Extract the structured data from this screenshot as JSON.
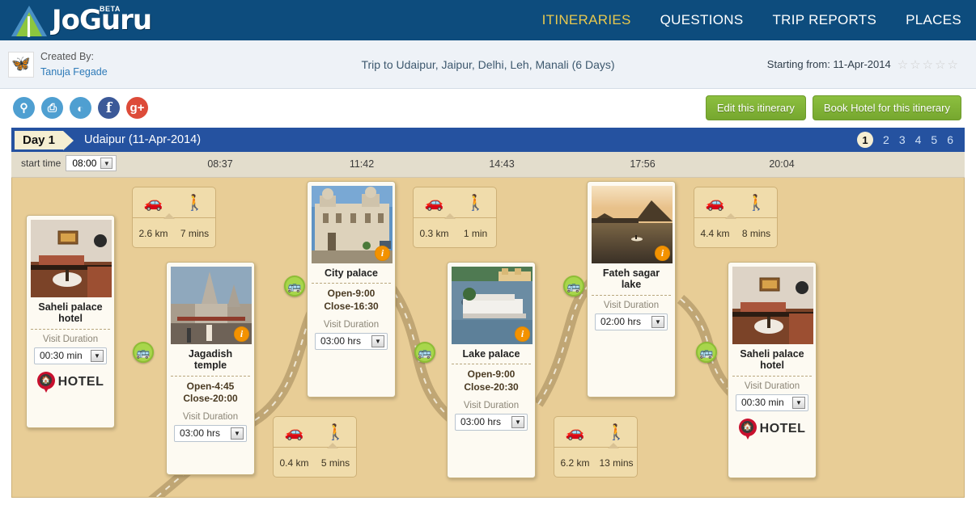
{
  "brand": {
    "name": "JoGuru",
    "beta": "BETA",
    "logo_icon": "road-triangle-logo"
  },
  "nav": {
    "items": [
      {
        "label": "ITINERARIES",
        "active": true
      },
      {
        "label": "QUESTIONS",
        "active": false
      },
      {
        "label": "TRIP REPORTS",
        "active": false
      },
      {
        "label": "PLACES",
        "active": false
      }
    ]
  },
  "subheader": {
    "created_by_label": "Created By:",
    "creator_name": "Tanuja Fegade",
    "trip_title": "Trip to Udaipur, Jaipur, Delhi, Leh, Manali (6 Days)",
    "starting_from": "Starting from: 11-Apr-2014",
    "rating_stars": 5,
    "rating_filled": 0
  },
  "actionbar": {
    "social": [
      {
        "name": "map-icon",
        "glyph": "⚑"
      },
      {
        "name": "print-icon",
        "glyph": "⎙"
      },
      {
        "name": "cloud-icon",
        "glyph": "◔"
      },
      {
        "name": "facebook-icon",
        "glyph": "f"
      },
      {
        "name": "googleplus-icon",
        "glyph": "g+"
      }
    ],
    "edit_button": "Edit this itinerary",
    "book_button": "Book Hotel for this itinerary"
  },
  "daybar": {
    "day_chip": "Day 1",
    "location": "Udaipur (11-Apr-2014)",
    "days": [
      "1",
      "2",
      "3",
      "4",
      "5",
      "6"
    ],
    "selected_day": "1"
  },
  "ruler": {
    "start_time_label": "start time",
    "start_time_value": "08:00",
    "ticks": [
      "08:37",
      "11:42",
      "14:43",
      "17:56",
      "20:04"
    ]
  },
  "timeline": {
    "places": [
      {
        "name": "Saheli palace hotel",
        "type": "hotel",
        "visit_duration_label": "Visit Duration",
        "duration": "00:30 min",
        "hotel_label": "HOTEL",
        "open": null,
        "close": null,
        "photo": "hotel-room-photo",
        "has_info_badge": false
      },
      {
        "name": "Jagadish temple",
        "type": "attraction",
        "visit_duration_label": "Visit Duration",
        "duration": "03:00 hrs",
        "open": "Open-4:45",
        "close": "Close-20:00",
        "photo": "temple-photo",
        "has_info_badge": true
      },
      {
        "name": "City palace",
        "type": "attraction",
        "visit_duration_label": "Visit Duration",
        "duration": "03:00 hrs",
        "open": "Open-9:00",
        "close": "Close-16:30",
        "photo": "palace-photo",
        "has_info_badge": true
      },
      {
        "name": "Lake palace",
        "type": "attraction",
        "visit_duration_label": "Visit Duration",
        "duration": "03:00 hrs",
        "open": "Open-9:00",
        "close": "Close-20:30",
        "photo": "lake-palace-photo",
        "has_info_badge": true
      },
      {
        "name": "Fateh sagar lake",
        "type": "attraction",
        "visit_duration_label": "Visit Duration",
        "duration": "02:00 hrs",
        "open": null,
        "close": null,
        "photo": "sunset-lake-photo",
        "has_info_badge": true
      },
      {
        "name": "Saheli palace hotel",
        "type": "hotel",
        "visit_duration_label": "Visit Duration",
        "duration": "00:30 min",
        "hotel_label": "HOTEL",
        "open": null,
        "close": null,
        "photo": "hotel-room-photo",
        "has_info_badge": false
      }
    ],
    "transports": [
      {
        "distance": "2.6 km",
        "time": "7 mins",
        "mode": "car"
      },
      {
        "distance": "0.4 km",
        "time": "5 mins",
        "mode": "walk"
      },
      {
        "distance": "0.3 km",
        "time": "1 min",
        "mode": "car"
      },
      {
        "distance": "6.2 km",
        "time": "13 mins",
        "mode": "walk"
      },
      {
        "distance": "4.4 km",
        "time": "8 mins",
        "mode": "car"
      }
    ],
    "bus_stops": 4,
    "icons": {
      "car": "car-icon",
      "walk": "walking-icon",
      "bus": "bus-icon"
    }
  },
  "colors": {
    "nav_blue": "#0d4c7d",
    "day_blue": "#2552a0",
    "sand": "#e8cd96",
    "green_button": "#8cbf3f",
    "accent_yellow": "#e8c84e",
    "info_orange": "#f39200"
  }
}
